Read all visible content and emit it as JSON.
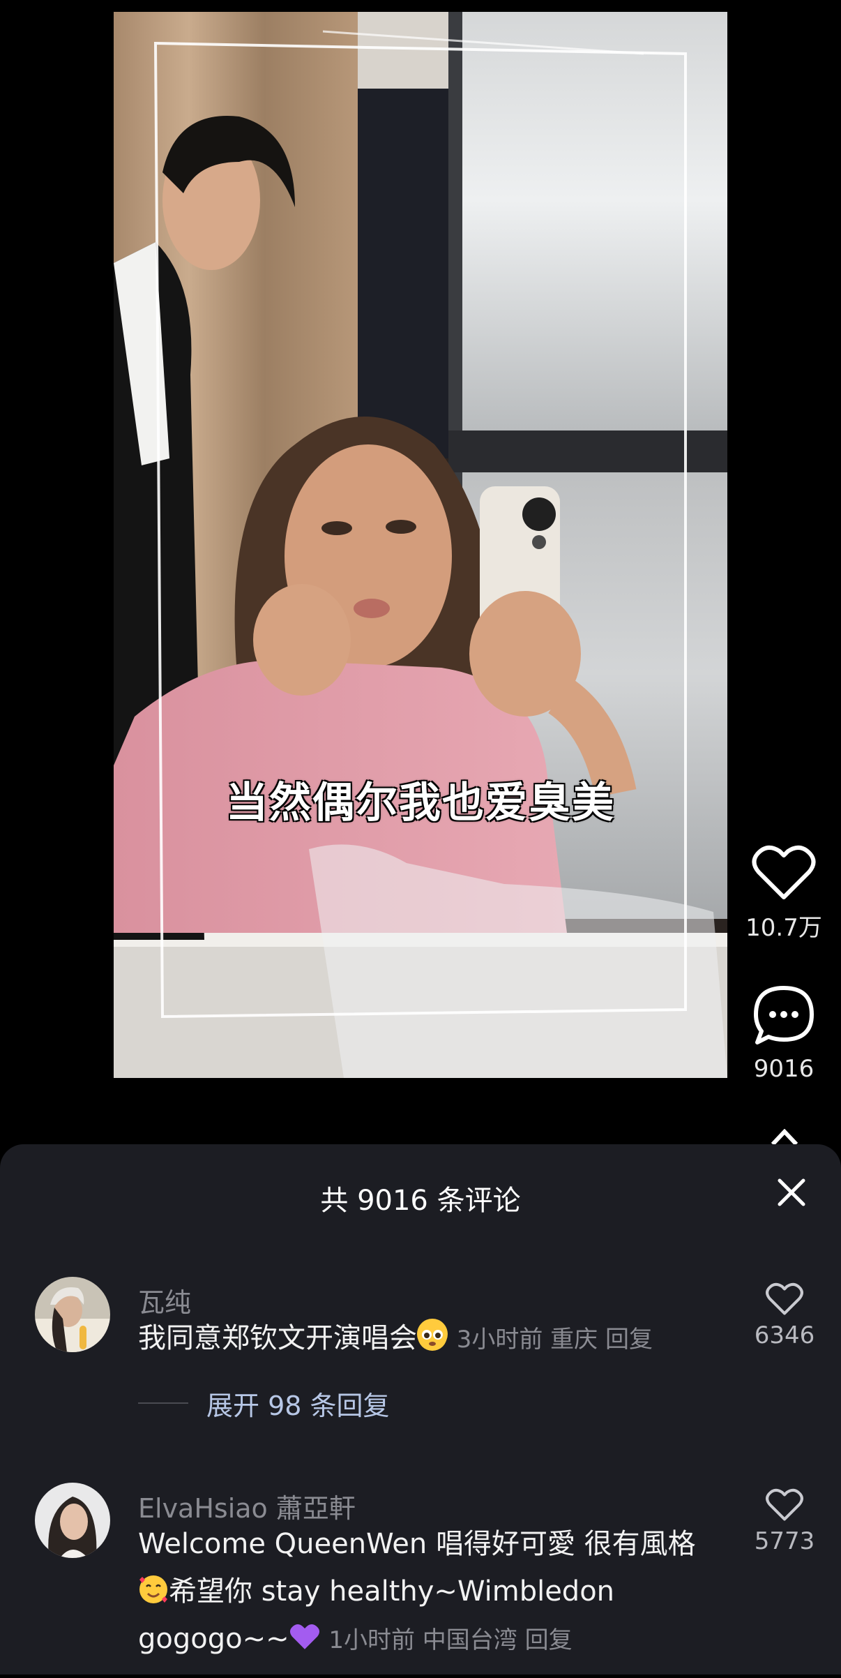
{
  "video": {
    "subtitle": "当然偶尔我也爱臭美"
  },
  "rail": {
    "like_count": "10.7万",
    "comment_count": "9016"
  },
  "comments_sheet": {
    "title": "共 9016 条评论",
    "comments": [
      {
        "username": "瓦纯",
        "text": "我同意郑钦文开演唱会",
        "emoji": "pleading-face",
        "time": "3小时前",
        "location": "重庆",
        "reply_label": "回复",
        "likes": "6346",
        "expand_label": "展开 98 条回复"
      },
      {
        "username": "ElvaHsiao 蕭亞軒",
        "text_line1": "Welcome QueenWen 唱得好可愛 很有風格",
        "text_line2": "希望你 stay healthy~Wimbledon",
        "text_line3": "gogogo~~",
        "emoji1": "smiling-face-with-hearts",
        "emoji2": "purple-heart",
        "time": "1小时前",
        "location": "中国台湾",
        "reply_label": "回复",
        "likes": "5773"
      }
    ]
  },
  "colors": {
    "sheet_bg": "#1c1d23",
    "meta_text": "#8a8b92",
    "link_text": "#b7c7e6"
  }
}
